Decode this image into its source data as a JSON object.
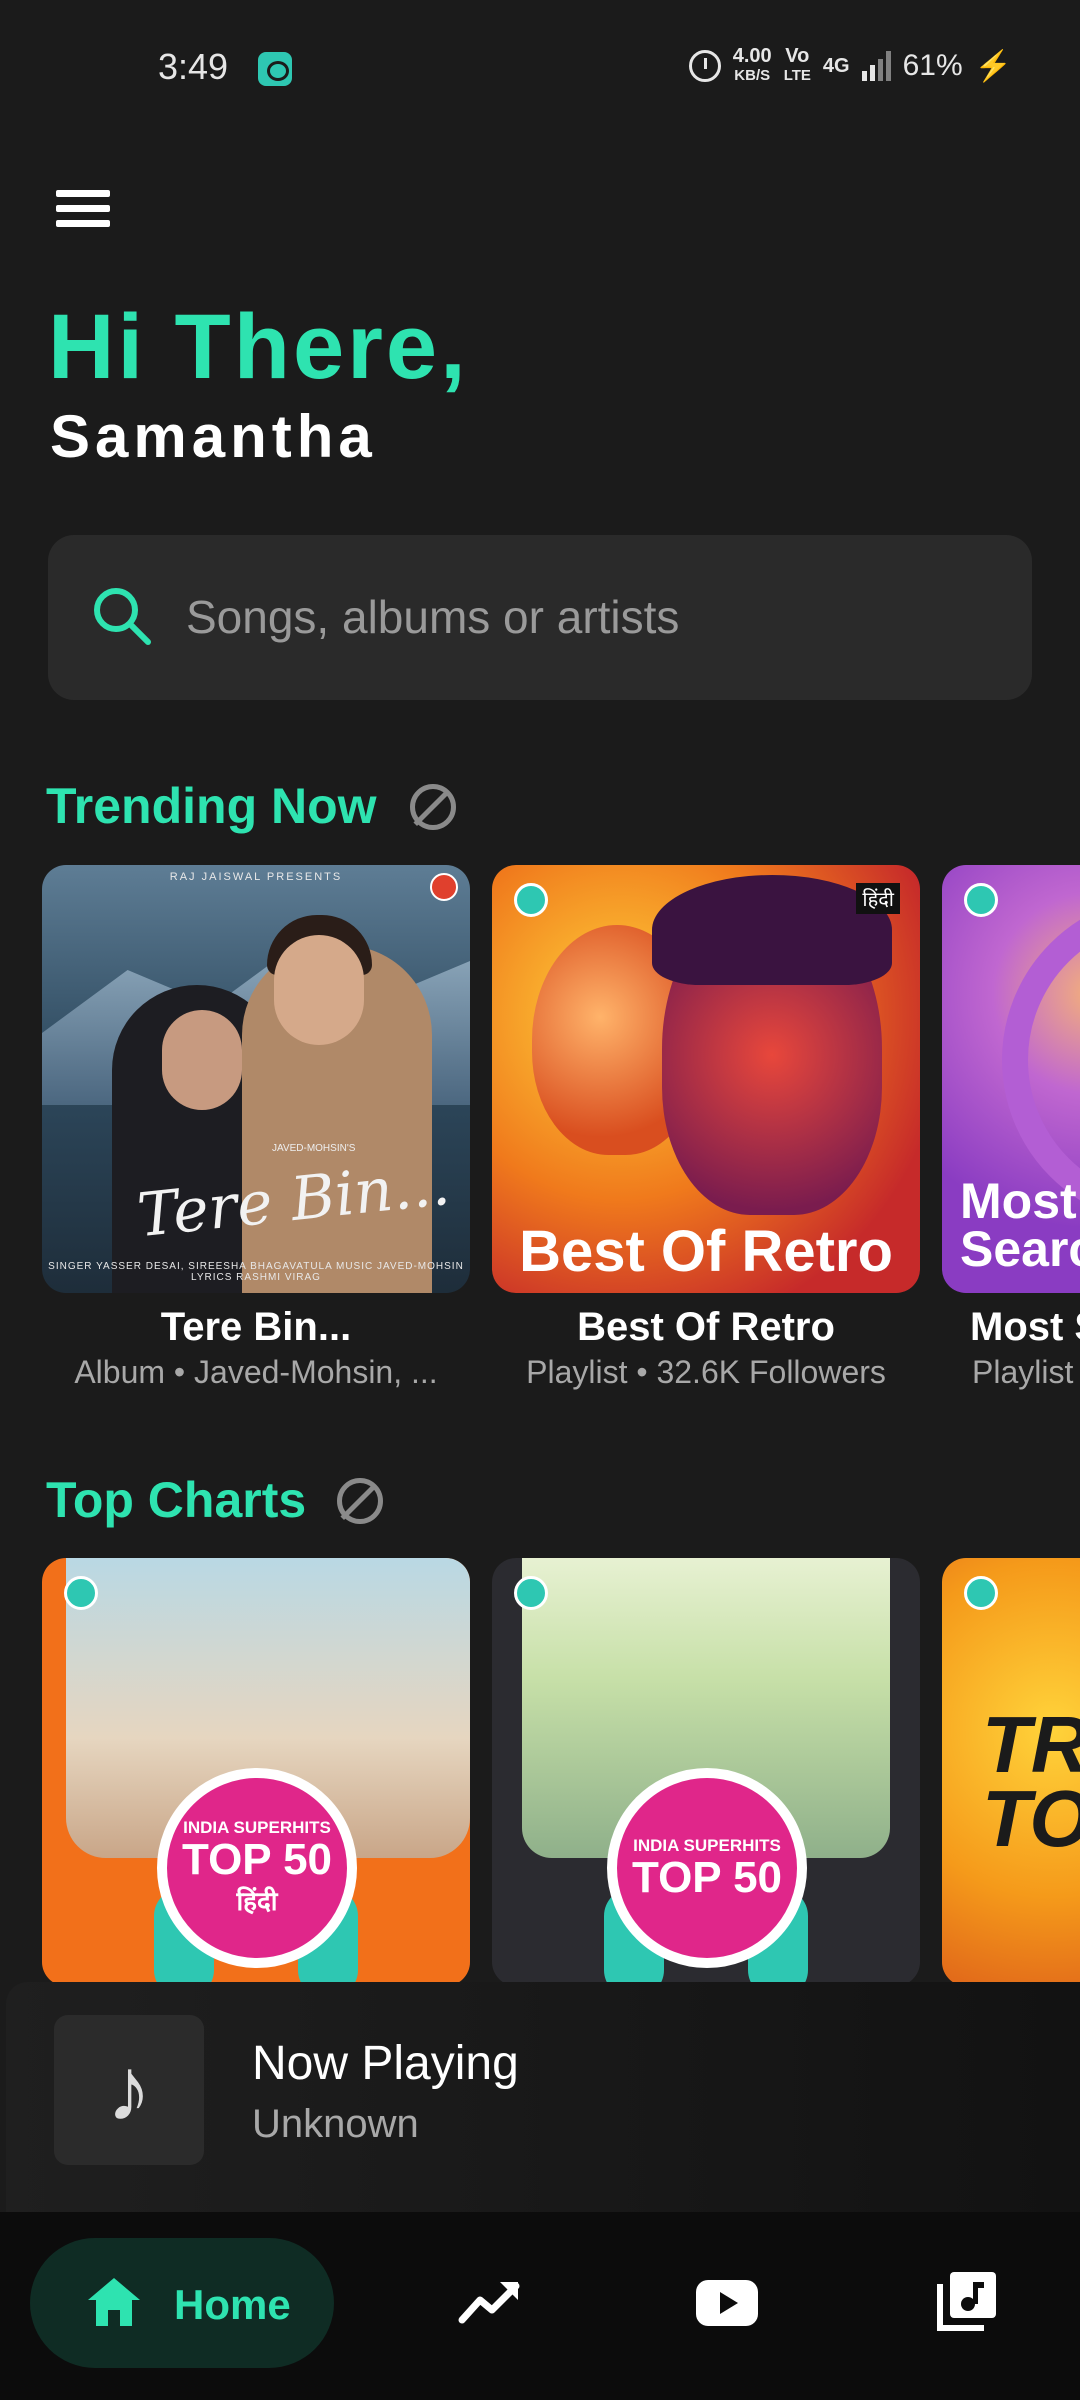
{
  "status_bar": {
    "time": "3:49",
    "net_speed": "4.00",
    "net_unit": "KB/S",
    "volte_top": "Vo",
    "volte_bottom": "LTE",
    "network": "4G",
    "battery": "61%"
  },
  "greeting": {
    "hello": "Hi There,",
    "name": "Samantha"
  },
  "search": {
    "placeholder": "Songs, albums or artists"
  },
  "trending": {
    "title": "Trending Now",
    "items": [
      {
        "title": "Tere Bin...",
        "subtitle": "Album • Javed-Mohsin,  ...",
        "art_script": "Tere Bin...",
        "art_top": "RAJ JAISWAL PRESENTS",
        "art_bottom": "SINGER YASSER DESAI, SIREESHA BHAGAVATULA  MUSIC JAVED-MOHSIN LYRICS RASHMI VIRAG",
        "art_credit": "JAVED-MOHSIN'S"
      },
      {
        "title": "Best Of Retro",
        "subtitle": "Playlist • 32.6K Followers",
        "art_text": "Best Of Retro",
        "art_tag": "हिंदी"
      },
      {
        "title": "Most S",
        "subtitle": "Playlist",
        "art_text_line1": "Most",
        "art_text_line2": "Searc"
      }
    ]
  },
  "top_charts": {
    "title": "Top Charts",
    "items": [
      {
        "badge_line1": "INDIA SUPERHITS",
        "badge_line2": "TOP 50",
        "badge_line3": "हिंदी"
      },
      {
        "badge_line1": "INDIA SUPERHITS",
        "badge_line2": "TOP 50"
      },
      {
        "art_line1": "TR",
        "art_line2": "TO"
      }
    ]
  },
  "now_playing": {
    "title": "Now Playing",
    "subtitle": "Unknown"
  },
  "bottom_nav": {
    "home_label": "Home",
    "active_color": "#2ee3b0"
  },
  "colors": {
    "accent": "#2ee3b0",
    "background": "#1b1b1b"
  }
}
